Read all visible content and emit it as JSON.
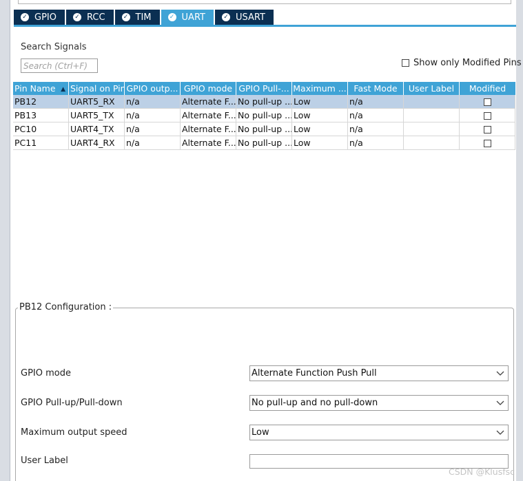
{
  "tabs": [
    {
      "label": "GPIO",
      "active": false
    },
    {
      "label": "RCC",
      "active": false
    },
    {
      "label": "TIM",
      "active": false
    },
    {
      "label": "UART",
      "active": true
    },
    {
      "label": "USART",
      "active": false
    }
  ],
  "search": {
    "label": "Search Signals",
    "placeholder": "Search (Ctrl+F)",
    "value": ""
  },
  "show_modified": {
    "label": "Show only Modified Pins",
    "checked": false
  },
  "table": {
    "columns": [
      "Pin Name",
      "Signal on Pin",
      "GPIO outp...",
      "GPIO mode",
      "GPIO Pull-...",
      "Maximum ...",
      "Fast Mode",
      "User Label",
      "Modified"
    ],
    "rows": [
      {
        "pin": "PB12",
        "signal": "UART5_RX",
        "output": "n/a",
        "mode": "Alternate F...",
        "pull": "No pull-up ...",
        "speed": "Low",
        "fast": "n/a",
        "label": "",
        "modified": false,
        "selected": true
      },
      {
        "pin": "PB13",
        "signal": "UART5_TX",
        "output": "n/a",
        "mode": "Alternate F...",
        "pull": "No pull-up ...",
        "speed": "Low",
        "fast": "n/a",
        "label": "",
        "modified": false,
        "selected": false
      },
      {
        "pin": "PC10",
        "signal": "UART4_TX",
        "output": "n/a",
        "mode": "Alternate F...",
        "pull": "No pull-up ...",
        "speed": "Low",
        "fast": "n/a",
        "label": "",
        "modified": false,
        "selected": false
      },
      {
        "pin": "PC11",
        "signal": "UART4_RX",
        "output": "n/a",
        "mode": "Alternate F...",
        "pull": "No pull-up ...",
        "speed": "Low",
        "fast": "n/a",
        "label": "",
        "modified": false,
        "selected": false
      }
    ]
  },
  "config": {
    "title": "PB12 Configuration :",
    "gpio_mode_label": "GPIO mode",
    "gpio_mode_value": "Alternate Function Push Pull",
    "pull_label": "GPIO Pull-up/Pull-down",
    "pull_value": "No pull-up and no pull-down",
    "speed_label": "Maximum output speed",
    "speed_value": "Low",
    "user_label_label": "User Label",
    "user_label_value": ""
  },
  "watermark": "CSDN @Klusfsc",
  "colors": {
    "tab_dark": "#0b2f52",
    "accent": "#3fa3d6",
    "selected_row": "#bcd0e6"
  },
  "icons": {
    "tab_check": "check-circle-icon",
    "sort": "sort-ascending-icon",
    "dropdown": "chevron-down-icon"
  }
}
